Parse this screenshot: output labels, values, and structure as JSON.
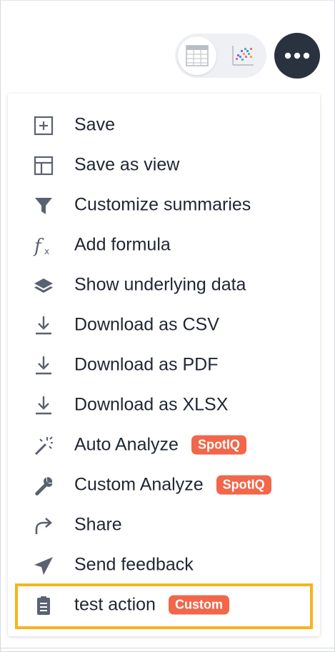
{
  "toolbar": {
    "view_toggle": {
      "options": [
        {
          "name": "table",
          "icon": "table-icon",
          "active": true
        },
        {
          "name": "chart",
          "icon": "chart-icon",
          "active": false
        }
      ]
    },
    "more_button": {
      "icon": "more-horizontal-icon"
    }
  },
  "menu": {
    "items": [
      {
        "label": "Save",
        "icon": "save-icon"
      },
      {
        "label": "Save as view",
        "icon": "layout-icon"
      },
      {
        "label": "Customize summaries",
        "icon": "filter-icon"
      },
      {
        "label": "Add formula",
        "icon": "formula-icon"
      },
      {
        "label": "Show underlying data",
        "icon": "layers-icon"
      },
      {
        "label": "Download as CSV",
        "icon": "download-icon"
      },
      {
        "label": "Download as PDF",
        "icon": "download-icon"
      },
      {
        "label": "Download as XLSX",
        "icon": "download-icon"
      },
      {
        "label": "Auto Analyze",
        "icon": "magic-wand-icon",
        "badge": "SpotIQ"
      },
      {
        "label": "Custom Analyze",
        "icon": "wrench-icon",
        "badge": "SpotIQ"
      },
      {
        "label": "Share",
        "icon": "share-arrow-icon"
      },
      {
        "label": "Send feedback",
        "icon": "send-icon"
      },
      {
        "label": "test action",
        "icon": "clipboard-icon",
        "badge": "Custom",
        "highlighted": true
      }
    ]
  },
  "colors": {
    "badge": "#f26649",
    "highlight": "#f5b51b",
    "icon": "#5a6170",
    "more_button": "#2a3240"
  }
}
